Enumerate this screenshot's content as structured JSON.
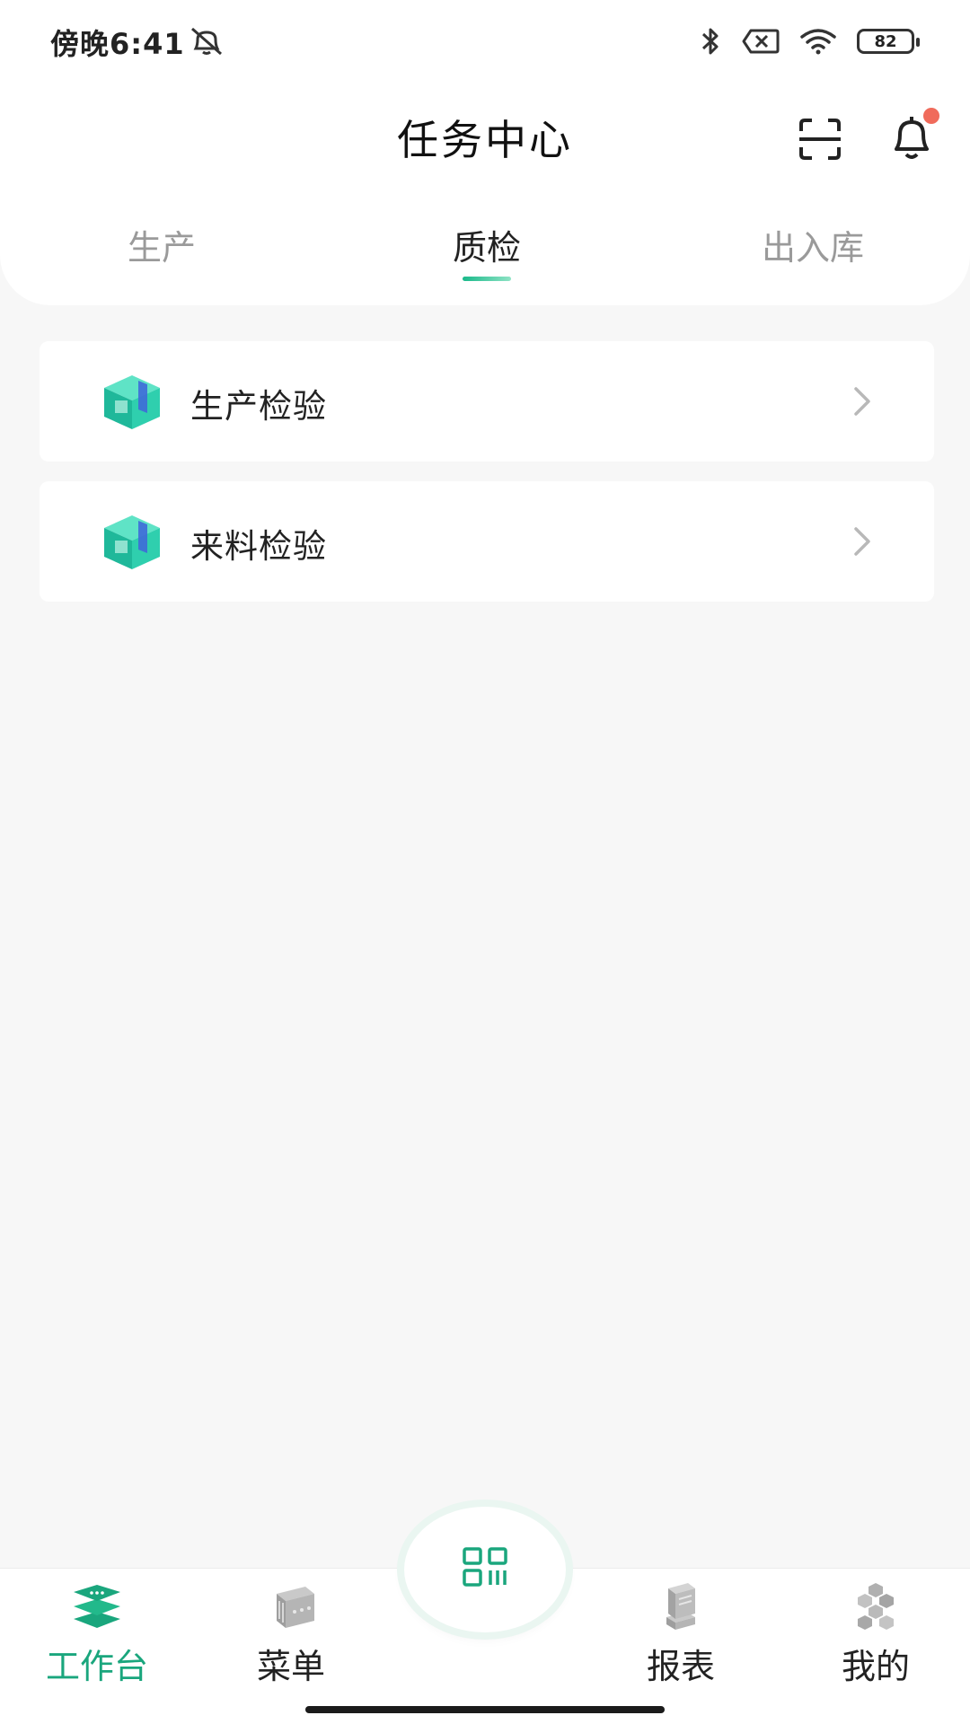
{
  "status_bar": {
    "time": "傍晚6:41",
    "battery": "82"
  },
  "header": {
    "title": "任务中心"
  },
  "tabs": [
    {
      "label": "生产",
      "active": false
    },
    {
      "label": "质检",
      "active": true
    },
    {
      "label": "出入库",
      "active": false
    }
  ],
  "list": [
    {
      "label": "生产检验",
      "icon": "cube-icon"
    },
    {
      "label": "来料检验",
      "icon": "cube-icon"
    }
  ],
  "bottom_nav": [
    {
      "label": "工作台",
      "icon": "stack-icon",
      "active": true
    },
    {
      "label": "菜单",
      "icon": "server-icon",
      "active": false
    },
    {
      "label": "报表",
      "icon": "report-icon",
      "active": false
    },
    {
      "label": "我的",
      "icon": "hexagon-cluster-icon",
      "active": false
    }
  ],
  "colors": {
    "accent": "#1aa67d",
    "notification_dot": "#f06b5b",
    "background": "#f7f7f7"
  }
}
